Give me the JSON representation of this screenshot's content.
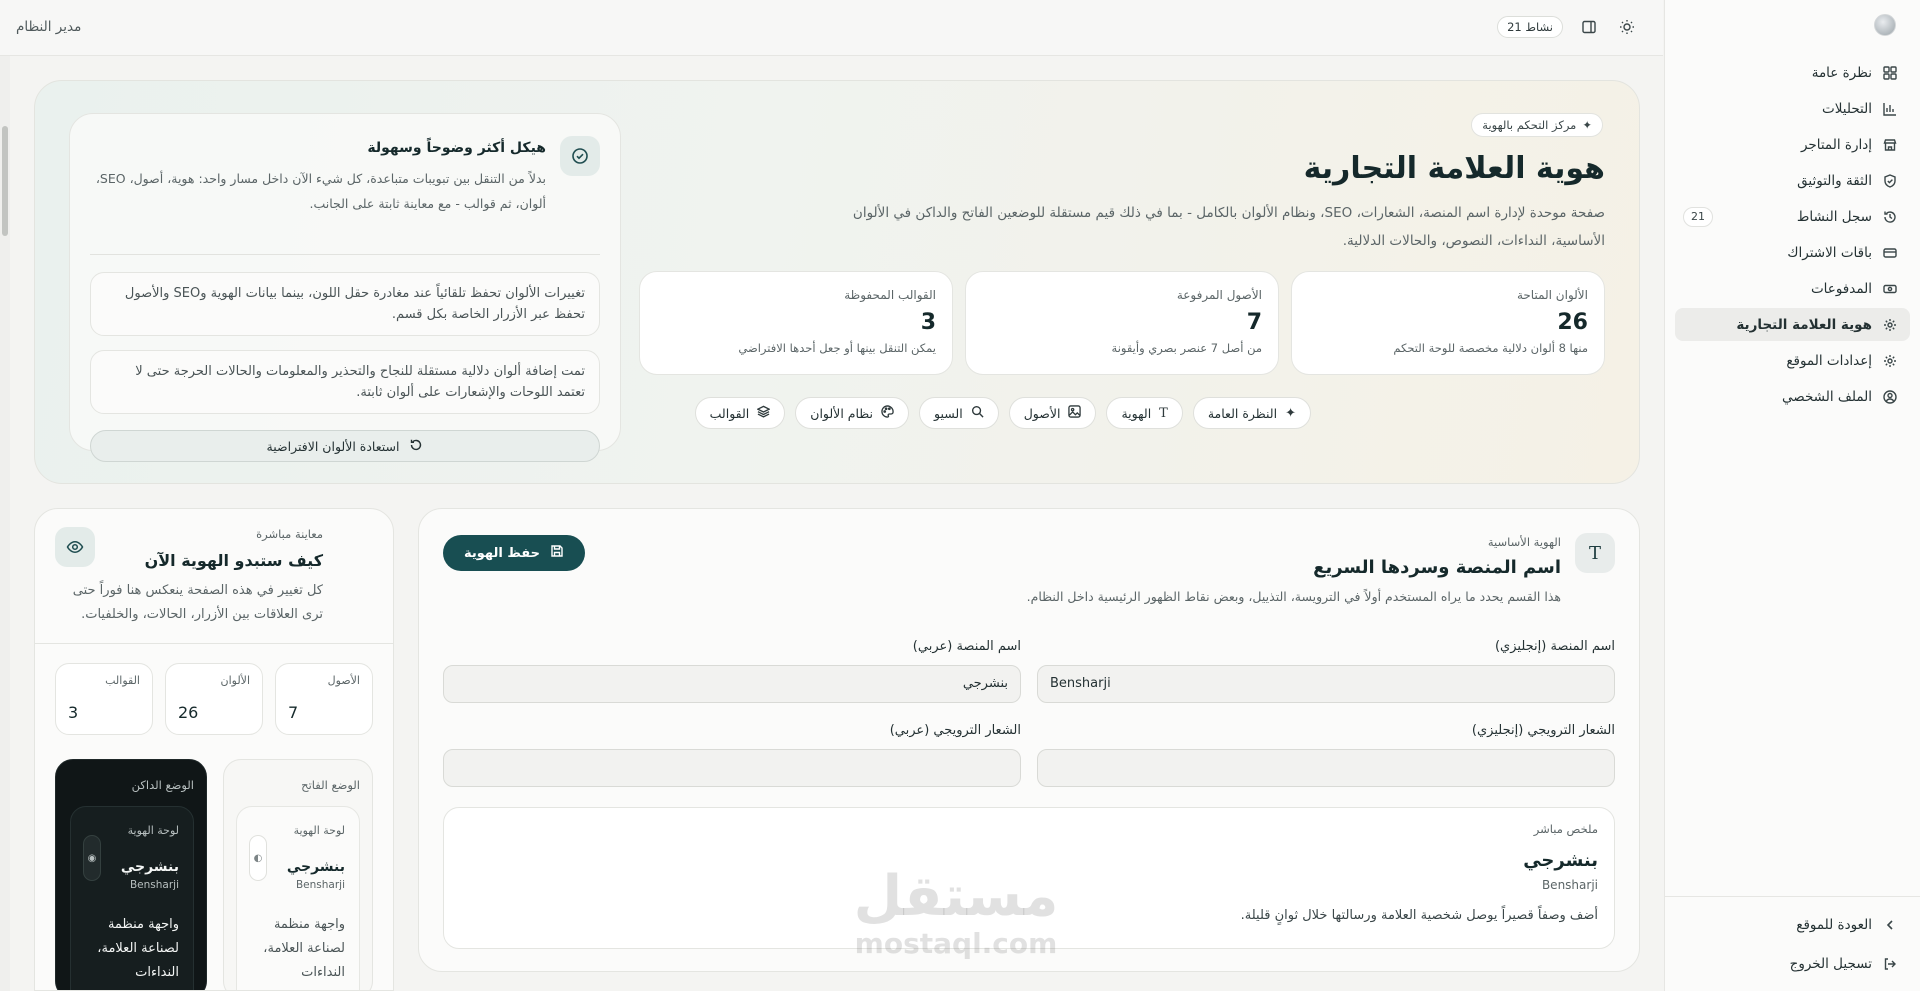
{
  "topbar": {
    "title": "مدير النظام",
    "activity_pill": "نشاط 21"
  },
  "sidebar": {
    "items": [
      {
        "label": "نظرة عامة",
        "icon": "grid-icon"
      },
      {
        "label": "التحليلات",
        "icon": "chart-icon"
      },
      {
        "label": "إدارة المتاجر",
        "icon": "store-icon"
      },
      {
        "label": "الثقة والتوثيق",
        "icon": "shield-icon"
      },
      {
        "label": "سجل النشاط",
        "icon": "history-icon",
        "badge": "21"
      },
      {
        "label": "باقات الاشتراك",
        "icon": "card-icon"
      },
      {
        "label": "المدفوعات",
        "icon": "cash-icon"
      },
      {
        "label": "هوية العلامة التجارية",
        "icon": "gear-icon",
        "active": true
      },
      {
        "label": "إعدادات الموقع",
        "icon": "gear-icon"
      },
      {
        "label": "الملف الشخصي",
        "icon": "user-circle-icon"
      }
    ],
    "back_label": "العودة للموقع",
    "logout_label": "تسجيل الخروج"
  },
  "hero": {
    "chip": "مركز التحكم بالهوية",
    "title": "هوية العلامة التجارية",
    "description": "صفحة موحدة لإدارة اسم المنصة، الشعارات، SEO، ونظام الألوان بالكامل - بما في ذلك قيم مستقلة للوضعين الفاتح والداكن في الألوان الأساسية، النداءات، النصوص، والحالات الدلالية.",
    "stats": [
      {
        "label": "الألوان المتاحة",
        "value": "26",
        "sub": "منها 8 ألوان دلالية مخصصة للوحة التحكم"
      },
      {
        "label": "الأصول المرفوعة",
        "value": "7",
        "sub": "من أصل 7 عنصر بصري وأيقونة"
      },
      {
        "label": "القوالب المحفوظة",
        "value": "3",
        "sub": "يمكن التنقل بينها أو جعل أحدها الافتراضي"
      }
    ],
    "tabs": [
      {
        "label": "النظرة العامة",
        "icon": "sparkles-icon"
      },
      {
        "label": "الهوية",
        "icon": "type-icon"
      },
      {
        "label": "الأصول",
        "icon": "image-icon"
      },
      {
        "label": "السيو",
        "icon": "search-icon"
      },
      {
        "label": "نظام الألوان",
        "icon": "palette-icon"
      },
      {
        "label": "القوالب",
        "icon": "layers-icon"
      }
    ],
    "panel": {
      "title": "هيكل أكثر وضوحاً وسهولة",
      "text": "بدلاً من التنقل بين تبويبات متباعدة، كل شيء الآن داخل مسار واحد: هوية، أصول، SEO، ألوان، ثم قوالب - مع معاينة ثابتة على الجانب.",
      "note1": "تغييرات الألوان تحفظ تلقائياً عند مغادرة حقل اللون، بينما بيانات الهوية وSEO والأصول تحفظ عبر الأزرار الخاصة بكل قسم.",
      "note2": "تمت إضافة ألوان دلالية مستقلة للنجاح والتحذير والمعلومات والحالات الحرجة حتى لا تعتمد اللوحات والإشعارات على ألوان ثابتة.",
      "reset_label": "استعادة الألوان الافتراضية"
    }
  },
  "form": {
    "eyebrow": "الهوية الأساسية",
    "title": "اسم المنصة وسردها السريع",
    "description": "هذا القسم يحدد ما يراه المستخدم أولاً في الترويسة، التذييل، وبعض نقاط الظهور الرئيسية داخل النظام.",
    "save_label": "حفظ الهوية",
    "name_en_label": "اسم المنصة (إنجليزي)",
    "name_en_value": "Bensharji",
    "name_ar_label": "اسم المنصة (عربي)",
    "name_ar_value": "بنشرجي",
    "tagline_en_label": "الشعار الترويجي (إنجليزي)",
    "tagline_en_value": "",
    "tagline_ar_label": "الشعار الترويجي (عربي)",
    "tagline_ar_value": "",
    "summary": {
      "eyebrow": "ملخص مباشر",
      "name": "بنشرجي",
      "name_en": "Bensharji",
      "description": "أضف وصفاً قصيراً يوصل شخصية العلامة ورسالتها خلال ثوانٍ قليلة."
    }
  },
  "watermark": {
    "ar": "مستقل",
    "en": "mostaql.com"
  },
  "preview": {
    "eyebrow": "معاينة مباشرة",
    "title": "كيف ستبدو الهوية الآن",
    "description": "كل تغيير في هذه الصفحة ينعكس هنا فوراً حتى ترى العلاقات بين الأزرار، الحالات، والخلفيات.",
    "mini_stats": [
      {
        "label": "الأصول",
        "value": "7"
      },
      {
        "label": "الألوان",
        "value": "26"
      },
      {
        "label": "القوالب",
        "value": "3"
      }
    ],
    "light_label": "الوضع الفاتح",
    "dark_label": "الوضع الداكن",
    "panel_label": "لوحة الهوية",
    "brand_name": "بنشرجي",
    "brand_en": "Bensharji",
    "body_text": "واجهة منظمة لصناعة العلامة، النداءات"
  },
  "colors": {
    "accent": "#184e52",
    "active_bg": "#ececea"
  }
}
